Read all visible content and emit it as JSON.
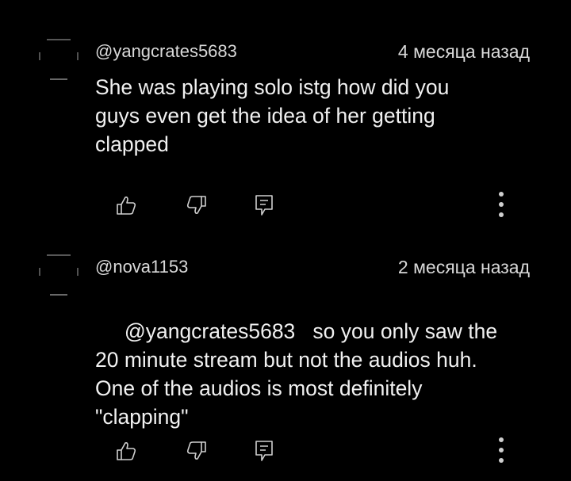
{
  "colors": {
    "background": "#000000",
    "text": "#f1f1f1",
    "muted": "#d9d9d9",
    "icon": "#cfcfcf"
  },
  "comments": [
    {
      "author": "@yangcrates5683",
      "time": "4 месяца назад",
      "text": "She was playing solo istg how did you\nguys even get the idea of her getting\nclapped",
      "actions": [
        "thumb-up-icon",
        "thumb-down-icon",
        "reply-icon",
        "more-vert-icon"
      ]
    },
    {
      "author": "@nova1153",
      "time": "2 месяца назад",
      "text": " @yangcrates5683   so you only saw the\n20 minute stream but not the audios huh.\nOne of the audios is most definitely\n\"clapping\"",
      "actions": [
        "thumb-up-icon",
        "thumb-down-icon",
        "reply-icon",
        "more-vert-icon"
      ]
    }
  ]
}
